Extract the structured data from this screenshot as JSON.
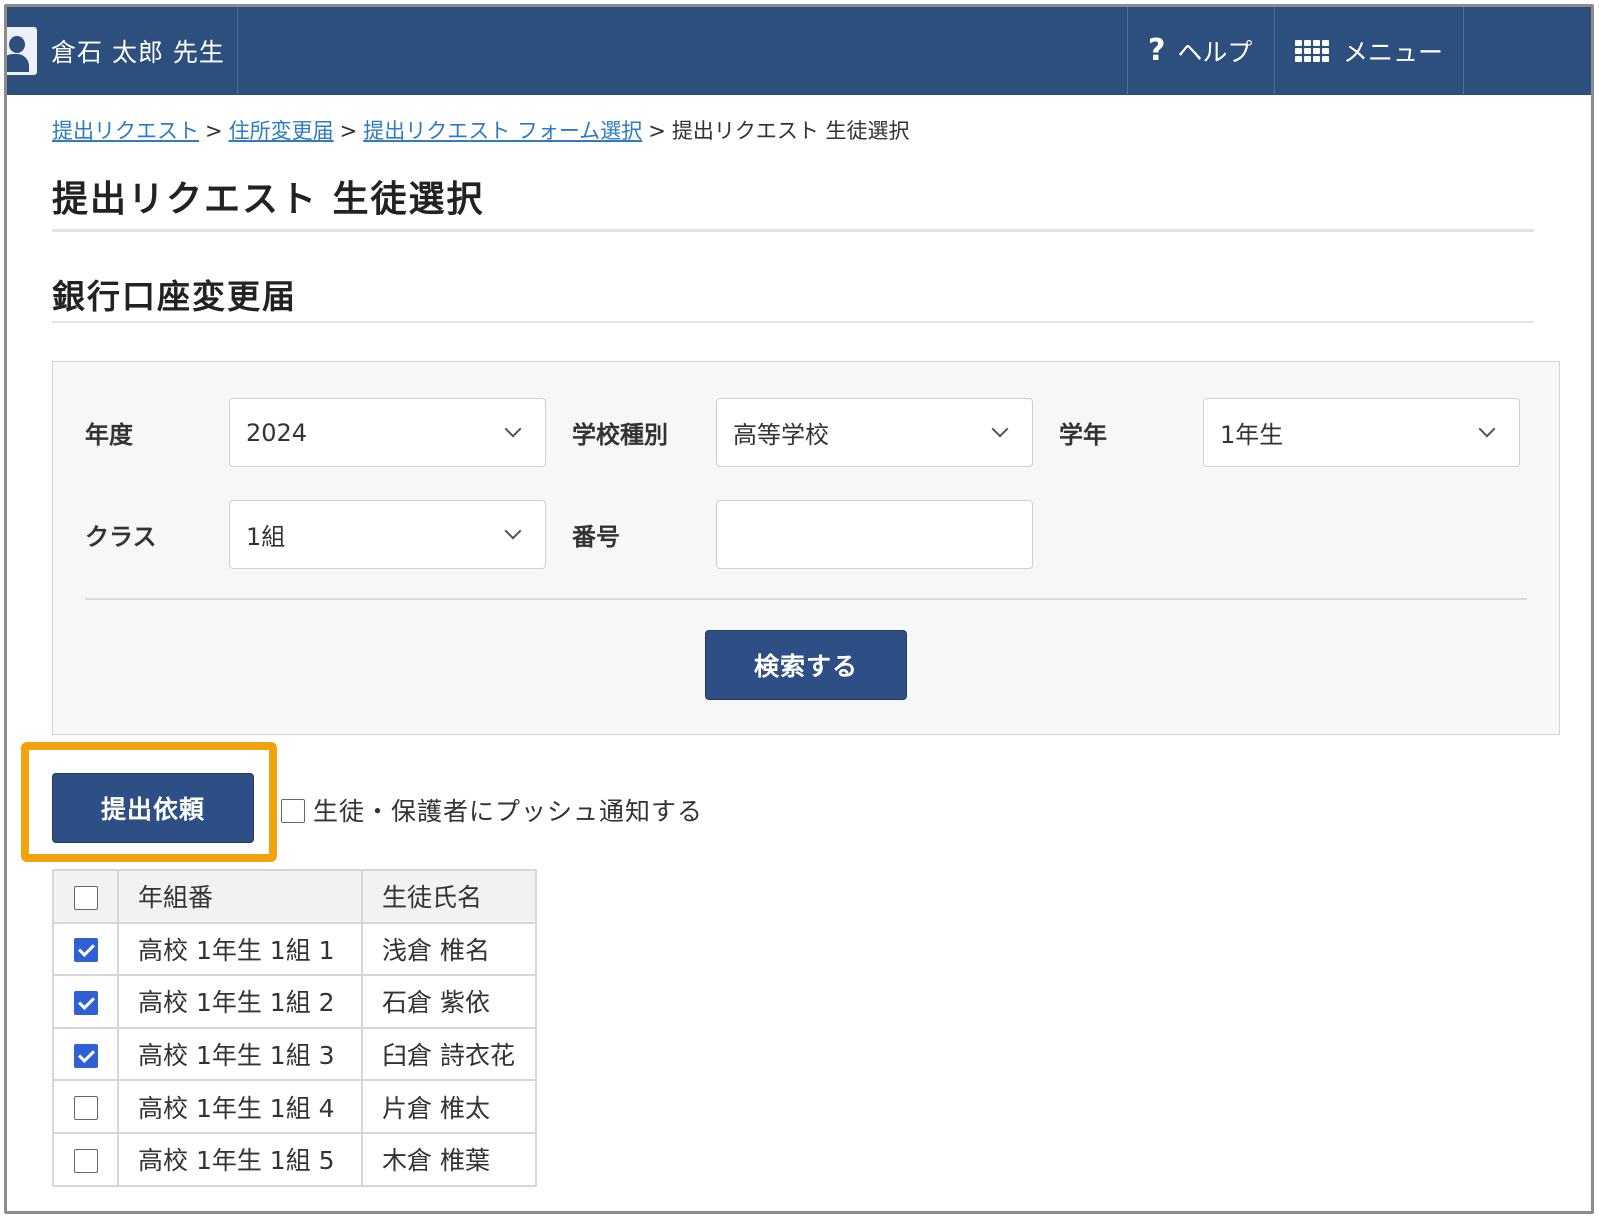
{
  "header": {
    "user_name": "倉石 太郎 先生",
    "help_label": "ヘルプ",
    "menu_label": "メニュー"
  },
  "breadcrumb": {
    "items": [
      "提出リクエスト",
      "住所変更届",
      "提出リクエスト フォーム選択"
    ],
    "current": "提出リクエスト 生徒選択",
    "separator": ">"
  },
  "page_title": "提出リクエスト 生徒選択",
  "form_title": "銀行口座変更届",
  "search": {
    "year_label": "年度",
    "year_value": "2024",
    "school_type_label": "学校種別",
    "school_type_value": "高等学校",
    "grade_label": "学年",
    "grade_value": "1年生",
    "class_label": "クラス",
    "class_value": "1組",
    "number_label": "番号",
    "number_value": "",
    "search_button": "検索する"
  },
  "actions": {
    "submit_button": "提出依頼",
    "push_label": "生徒・保護者にプッシュ通知する",
    "push_checked": false
  },
  "table": {
    "headers": [
      "年組番",
      "生徒氏名"
    ],
    "rows": [
      {
        "class": "高校 1年生 1組 1",
        "name": "浅倉 椎名",
        "checked": true
      },
      {
        "class": "高校 1年生 1組 2",
        "name": "石倉 紫依",
        "checked": true
      },
      {
        "class": "高校 1年生 1組 3",
        "name": "臼倉 詩衣花",
        "checked": true
      },
      {
        "class": "高校 1年生 1組 4",
        "name": "片倉 椎太",
        "checked": false
      },
      {
        "class": "高校 1年生 1組 5",
        "name": "木倉 椎葉",
        "checked": false
      }
    ]
  },
  "colors": {
    "header_bg": "#2d4f7e",
    "button_bg": "#2d4f86",
    "highlight": "#f2a20c",
    "link": "#2f7bc4",
    "checkbox_checked": "#2f61d5"
  }
}
